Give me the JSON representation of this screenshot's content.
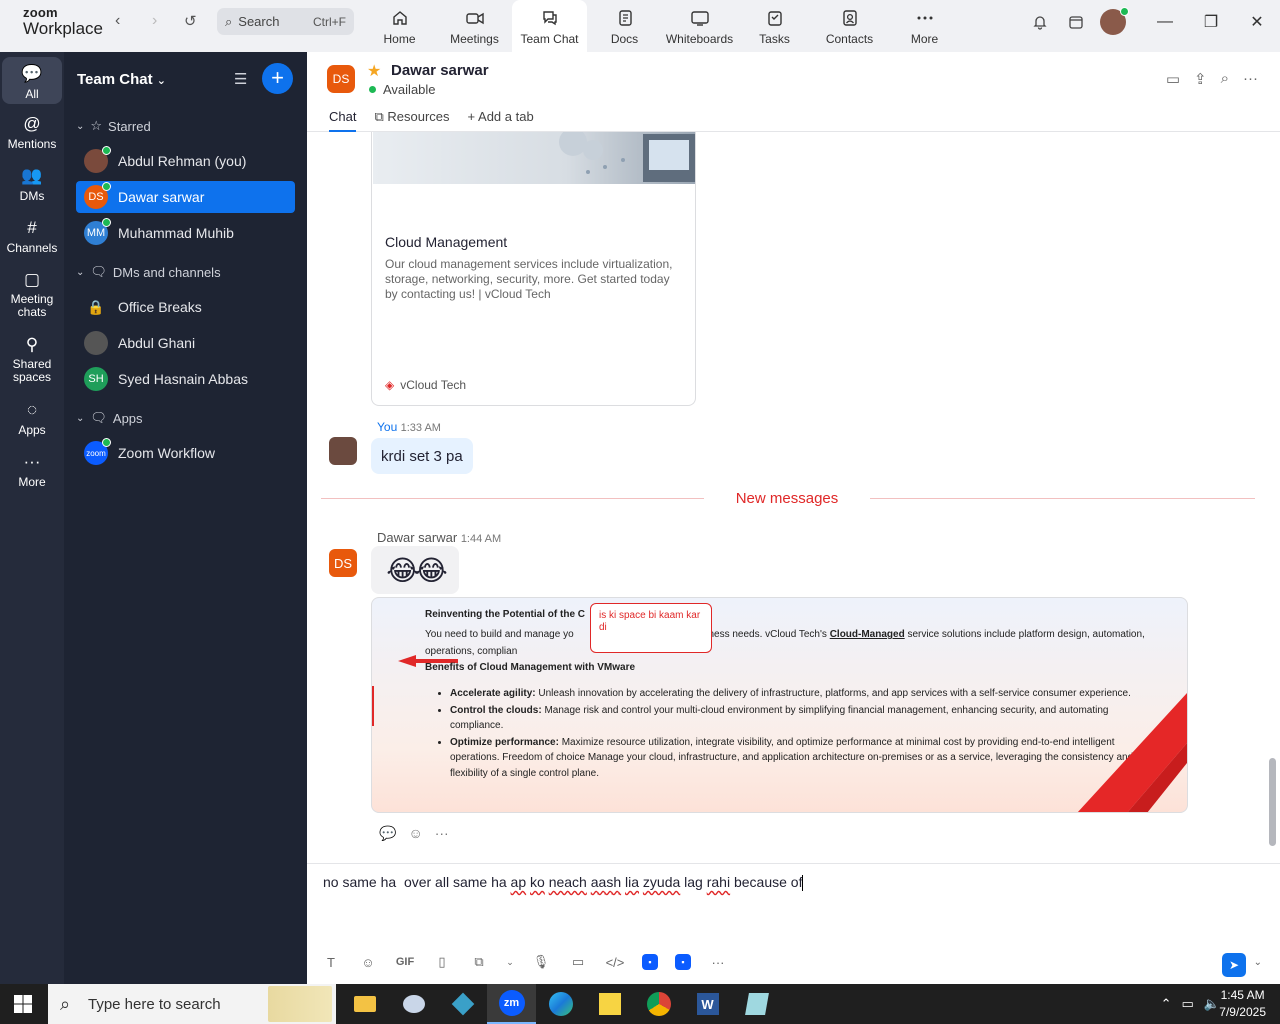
{
  "app": {
    "logo_top": "zoom",
    "logo_bottom": "Workplace"
  },
  "search": {
    "label": "Search",
    "shortcut": "Ctrl+F"
  },
  "nav_tabs": [
    {
      "label": "Home",
      "icon": "home-icon"
    },
    {
      "label": "Meetings",
      "icon": "video-icon"
    },
    {
      "label": "Team Chat",
      "icon": "chat-icon",
      "active": true
    },
    {
      "label": "Docs",
      "icon": "doc-icon"
    },
    {
      "label": "Whiteboards",
      "icon": "whiteboard-icon"
    },
    {
      "label": "Tasks",
      "icon": "tasks-icon"
    },
    {
      "label": "Contacts",
      "icon": "contacts-icon"
    },
    {
      "label": "More",
      "icon": "more-icon"
    }
  ],
  "left_rail": [
    {
      "label": "All",
      "icon": "chat-bubble-icon"
    },
    {
      "label": "Mentions",
      "icon": "at-icon"
    },
    {
      "label": "DMs",
      "icon": "people-icon"
    },
    {
      "label": "Channels",
      "icon": "hash-icon"
    },
    {
      "label": "Meeting chats",
      "icon": "calendar-icon"
    },
    {
      "label": "Shared spaces",
      "icon": "share-icon"
    },
    {
      "label": "Apps",
      "icon": "apps-icon"
    },
    {
      "label": "More",
      "icon": "ellipsis-icon"
    }
  ],
  "sidebar": {
    "title": "Team Chat",
    "starred_label": "Starred",
    "starred": [
      {
        "name": "Abdul Rehman (you)",
        "initials": "",
        "color": "#7a4a3c"
      },
      {
        "name": "Dawar sarwar",
        "initials": "DS",
        "color": "#e8590c"
      },
      {
        "name": "Muhammad Muhib",
        "initials": "MM",
        "color": "#2f7fd4"
      }
    ],
    "dms_label": "DMs and channels",
    "dms": [
      {
        "name": "Office Breaks",
        "initials": "",
        "color": ""
      },
      {
        "name": "Abdul Ghani",
        "initials": "",
        "color": "#555"
      },
      {
        "name": "Syed Hasnain Abbas",
        "initials": "SH",
        "color": "#1f9e5a"
      }
    ],
    "apps_label": "Apps",
    "apps": [
      {
        "name": "Zoom Workflow",
        "initials": "zoom",
        "color": "#0b5cff"
      }
    ]
  },
  "chat": {
    "initials": "DS",
    "name": "Dawar sarwar",
    "status": "Available",
    "tabs": [
      "Chat",
      "Resources",
      "Add a tab"
    ]
  },
  "link_card": {
    "title": "Cloud Management",
    "description": "Our cloud management services include virtualization, storage, networking, security, more. Get started today by contacting us! | vCloud Tech",
    "source": "vCloud Tech"
  },
  "msg_you": {
    "sender": "You",
    "time": "1:33 AM",
    "text": "krdi set 3 pa"
  },
  "new_messages_label": "New messages",
  "msg_dawar": {
    "sender": "Dawar sarwar",
    "time": "1:44 AM",
    "initials": "DS",
    "emoji": "😂😂"
  },
  "screenshot": {
    "heading": "Reinventing the Potential of the C",
    "para_a": "You need to build and manage yo",
    "para_b": "usiness needs. vCloud Tech's",
    "para_link": "Cloud-Managed",
    "para_c": "service solutions include platform design, automation, operations, complian",
    "callout": "is ki space bi kaam kar di",
    "heading2": "Benefits of Cloud Management with VMware",
    "bullets": [
      {
        "bold": "Accelerate agility:",
        "text": "Unleash innovation by accelerating the delivery of infrastructure, platforms, and app services with a self-service consumer experience."
      },
      {
        "bold": "Control the clouds:",
        "text": "Manage risk and control your multi-cloud environment by simplifying financial management, enhancing security, and automating compliance."
      },
      {
        "bold": "Optimize performance:",
        "text": "Maximize resource utilization, integrate visibility, and optimize performance at minimal cost by providing end-to-end intelligent operations.  Freedom of choice Manage your cloud, infrastructure, and application architecture on-premises or as a service, leveraging the consistency and flexibility of a single control plane."
      }
    ]
  },
  "composer": {
    "t1": "no same ha  over all same ha ",
    "w1": "ap",
    "s1": " ",
    "w2": "ko",
    "s2": " ",
    "w3": "neach",
    "s3": " ",
    "w4": "aash",
    "s4": " ",
    "w5": "lia",
    "s5": " ",
    "w6": "zyuda",
    "s6": " lag ",
    "w7": "rahi",
    "t2": " because of",
    "gif_label": "GIF"
  },
  "taskbar": {
    "search_placeholder": "Type here to search",
    "time": "1:45 AM",
    "date": "7/9/2025"
  },
  "colors": {
    "accent": "#0e72ed",
    "sidebar_bg": "#1e2433",
    "rail_bg": "#252b3b",
    "alert": "#e02828"
  }
}
